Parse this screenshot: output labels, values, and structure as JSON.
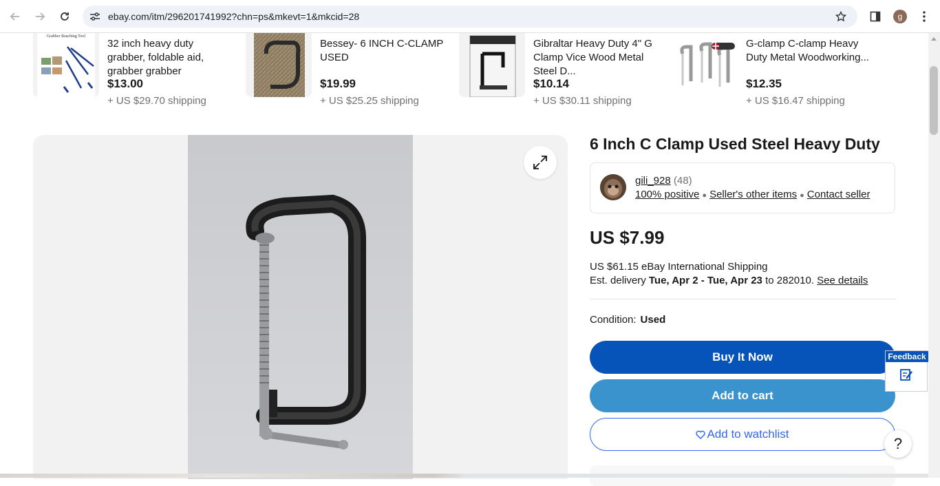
{
  "browser": {
    "url": "ebay.com/itm/296201741992?chn=ps&mkevt=1&mkcid=28",
    "profile_initial": "g"
  },
  "carousel": [
    {
      "title": "32 inch heavy duty grabber, foldable aid, grabber grabber",
      "price": "$13.00",
      "shipping": "+ US $29.70 shipping",
      "thumb_caption": "Grabber Reaching Tool"
    },
    {
      "title": "Bessey- 6 INCH C-CLAMP USED",
      "price": "$19.99",
      "shipping": "+ US $25.25 shipping"
    },
    {
      "title": "Gibraltar Heavy Duty 4\" G Clamp Vice Wood Metal Steel D...",
      "price": "$10.14",
      "shipping": "+ US $30.11 shipping"
    },
    {
      "title": "G-clamp C-clamp Heavy Duty Metal Woodworking...",
      "price": "$12.35",
      "shipping": "+ US $16.47 shipping"
    }
  ],
  "listing": {
    "title": "6 Inch C Clamp Used Steel Heavy Duty",
    "seller": {
      "name": "gili_928",
      "feedback_count": "(48)",
      "positive": "100% positive",
      "other_items": "Seller's other items",
      "contact": "Contact seller"
    },
    "price": "US $7.99",
    "shipping_line": "US $61.15 eBay International Shipping",
    "delivery_prefix": "Est. delivery",
    "delivery_dates": "Tue, Apr 2 - Tue, Apr 23",
    "delivery_to": "to 282010.",
    "see_details": "See details",
    "condition_label": "Condition:",
    "condition_value": "Used",
    "buy_now": "Buy It Now",
    "add_to_cart": "Add to cart",
    "add_to_watchlist": "Add to watchlist"
  },
  "feedback_label": "Feedback",
  "help_label": "?",
  "colors": {
    "buy_now": "#0654ba",
    "add_to_cart": "#3a93cc",
    "watchlist": "#3665f3"
  }
}
